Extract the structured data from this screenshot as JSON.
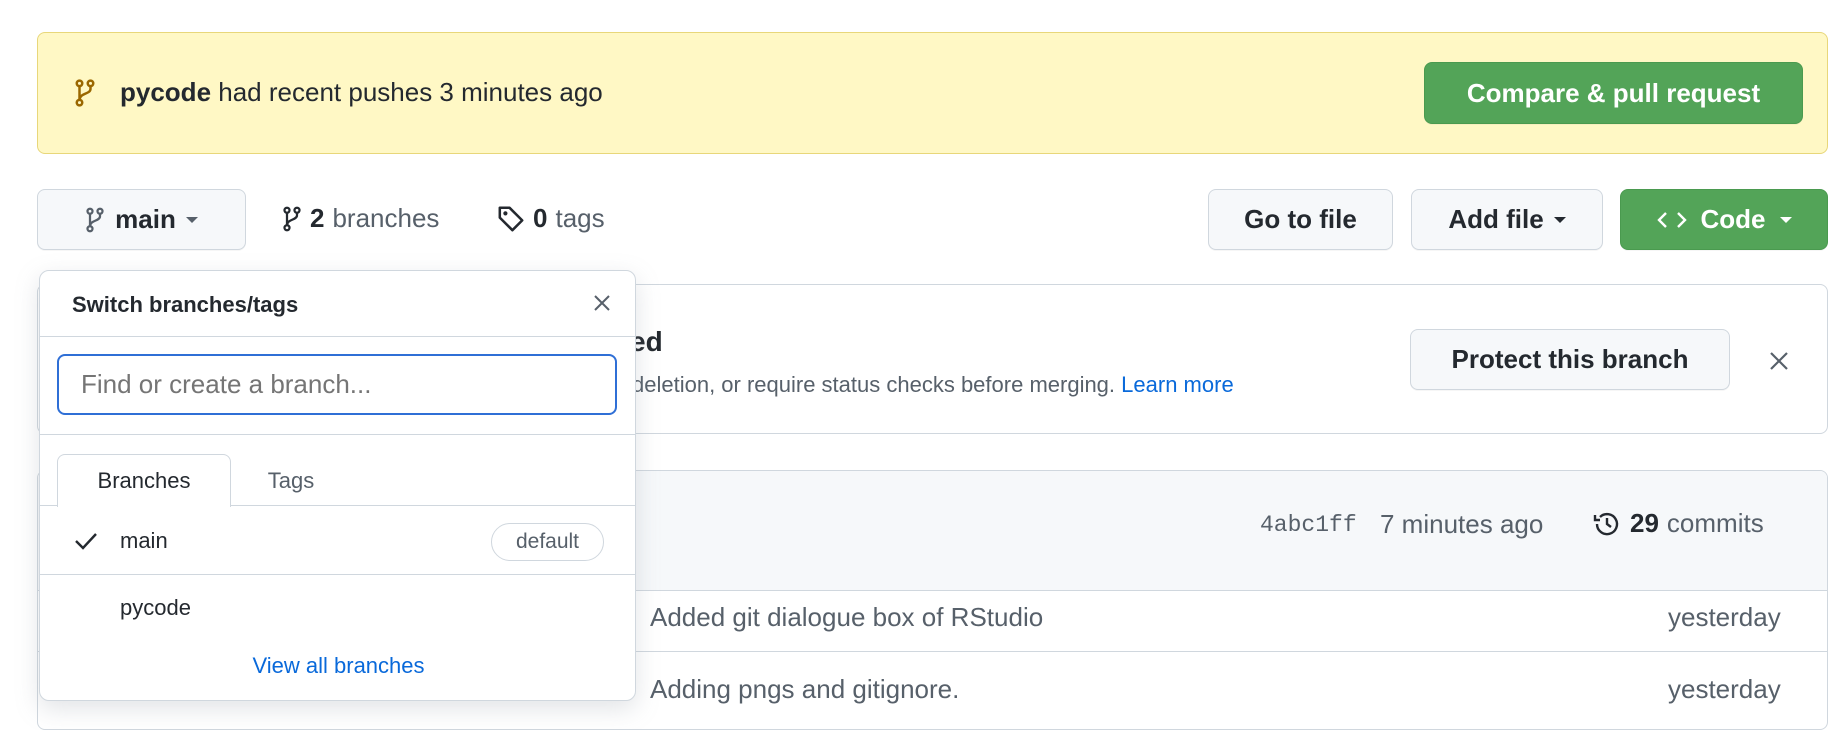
{
  "banner": {
    "branch": "pycode",
    "message": "had recent pushes 3 minutes ago",
    "compare_button": "Compare & pull request"
  },
  "toolbar": {
    "current_branch": "main",
    "branches_count": "2",
    "branches_label": "branches",
    "tags_count": "0",
    "tags_label": "tags",
    "go_to_file": "Go to file",
    "add_file": "Add file",
    "code": "Code"
  },
  "protect": {
    "title_fragment": "ed",
    "desc_fragment": "deletion, or require status checks before merging.",
    "learn_more": "Learn more",
    "button": "Protect this branch"
  },
  "commits": {
    "sha": "4abc1ff",
    "time": "7 minutes ago",
    "count": "29",
    "count_label": "commits",
    "rows": [
      {
        "message": "Added git dialogue box of RStudio",
        "time": "yesterday"
      },
      {
        "message": "Adding pngs and gitignore.",
        "time": "yesterday"
      }
    ]
  },
  "dropdown": {
    "title": "Switch branches/tags",
    "placeholder": "Find or create a branch...",
    "tabs": [
      "Branches",
      "Tags"
    ],
    "branches": [
      {
        "name": "main",
        "selected": true,
        "badge": "default"
      },
      {
        "name": "pycode",
        "selected": false
      }
    ],
    "view_all": "View all branches"
  },
  "colors": {
    "accent": "#53a458",
    "link": "#0969da",
    "banner_bg": "#fff8c5"
  }
}
